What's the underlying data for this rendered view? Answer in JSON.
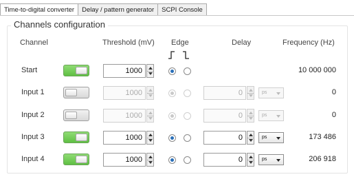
{
  "tabs": [
    {
      "label": "Time-to-digital converter",
      "active": true
    },
    {
      "label": "Delay / pattern generator",
      "active": false
    },
    {
      "label": "SCPI Console",
      "active": false
    }
  ],
  "group": {
    "title": "Channels configuration"
  },
  "headers": {
    "channel": "Channel",
    "threshold": "Threshold (mV)",
    "edge": "Edge",
    "delay": "Delay",
    "frequency": "Frequency (Hz)"
  },
  "edge_icons": [
    "rising-edge-icon",
    "falling-edge-icon"
  ],
  "colors": {
    "toggle_on": "#5fbf43",
    "radio_selected": "#2a6fb8"
  },
  "rows": [
    {
      "label": "Start",
      "enabled": true,
      "threshold": "1000",
      "edge": "rising",
      "has_delay": false,
      "delay": "",
      "unit": "",
      "frequency": "10 000 000"
    },
    {
      "label": "Input 1",
      "enabled": false,
      "threshold": "1000",
      "edge": "rising",
      "has_delay": true,
      "delay": "0",
      "unit": "ps",
      "frequency": "0"
    },
    {
      "label": "Input 2",
      "enabled": false,
      "threshold": "1000",
      "edge": "rising",
      "has_delay": true,
      "delay": "0",
      "unit": "ps",
      "frequency": "0"
    },
    {
      "label": "Input 3",
      "enabled": true,
      "threshold": "1000",
      "edge": "rising",
      "has_delay": true,
      "delay": "0",
      "unit": "ps",
      "frequency": "173 486"
    },
    {
      "label": "Input 4",
      "enabled": true,
      "threshold": "1000",
      "edge": "rising",
      "has_delay": true,
      "delay": "0",
      "unit": "ps",
      "frequency": "206 918"
    }
  ]
}
